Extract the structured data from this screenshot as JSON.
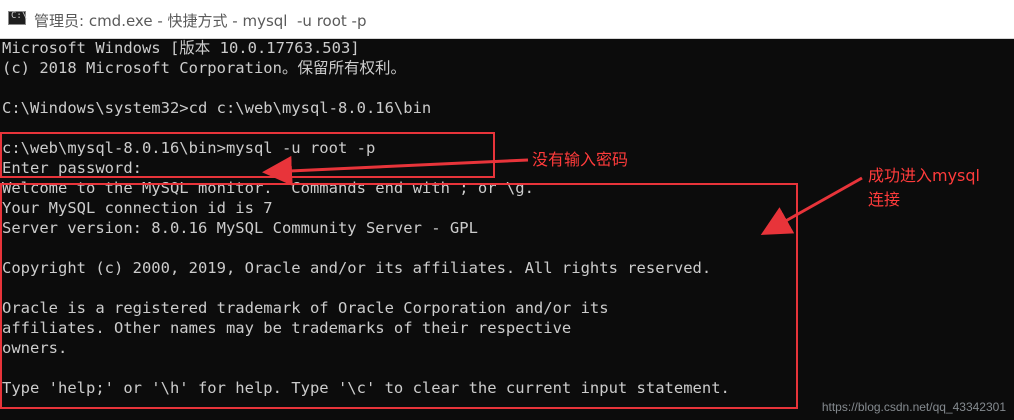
{
  "window": {
    "title": "管理员: cmd.exe - 快捷方式 - mysql  -u root -p",
    "icon": "cmd-icon",
    "icon_glyph": "C:\\"
  },
  "console": {
    "lines": [
      "Microsoft Windows [版本 10.0.17763.503]",
      "(c) 2018 Microsoft Corporation。保留所有权利。",
      "",
      "C:\\Windows\\system32>cd c:\\web\\mysql-8.0.16\\bin",
      "",
      "c:\\web\\mysql-8.0.16\\bin>mysql -u root -p",
      "Enter password:",
      "Welcome to the MySQL monitor.  Commands end with ; or \\g.",
      "Your MySQL connection id is 7",
      "Server version: 8.0.16 MySQL Community Server - GPL",
      "",
      "Copyright (c) 2000, 2019, Oracle and/or its affiliates. All rights reserved.",
      "",
      "Oracle is a registered trademark of Oracle Corporation and/or its",
      "affiliates. Other names may be trademarks of their respective",
      "owners.",
      "",
      "Type 'help;' or '\\h' for help. Type '\\c' to clear the current input statement."
    ]
  },
  "annotations": {
    "no_password_label": "没有输入密码",
    "success_label_line1": "成功进入mysql",
    "success_label_line2": "连接",
    "color": "#e8343a"
  },
  "watermark": "https://blog.csdn.net/qq_43342301",
  "colors": {
    "console_bg": "#0c0c0c",
    "console_text": "#cccccc",
    "titlebar_bg": "#ffffff"
  }
}
